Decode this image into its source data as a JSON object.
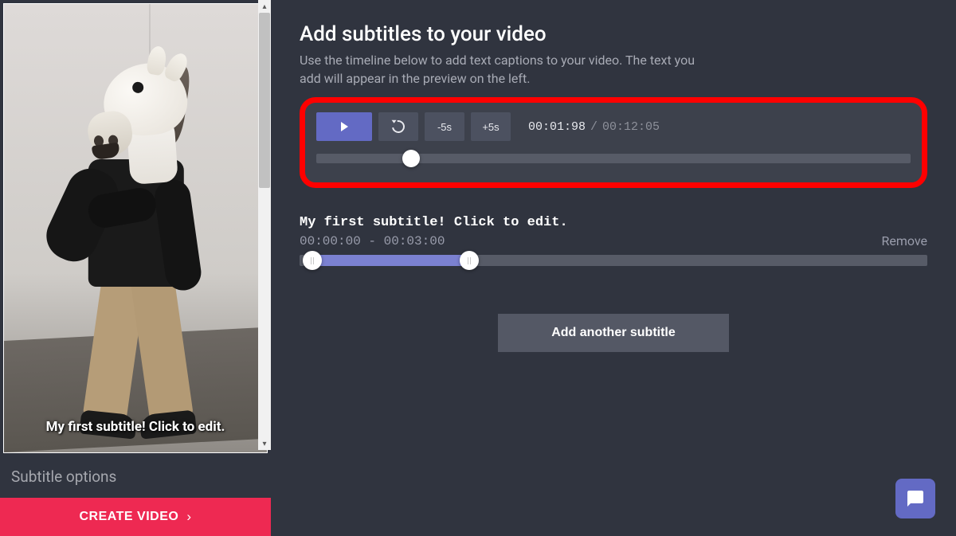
{
  "preview": {
    "subtitle_overlay": "My first subtitle! Click to edit."
  },
  "sidebar": {
    "subtitle_options_header": "Subtitle options",
    "create_button": "CREATE VIDEO"
  },
  "main": {
    "title": "Add subtitles to your video",
    "description": "Use the timeline below to add text captions to your video. The text you add will appear in the preview on the left."
  },
  "controls": {
    "minus5_label": "-5s",
    "plus5_label": "+5s",
    "current_time": "00:01:98",
    "total_time": "00:12:05",
    "progress_percent": 16
  },
  "subtitle": {
    "text": "My first subtitle! Click to edit.",
    "range_text": "00:00:00 - 00:03:00",
    "remove_label": "Remove",
    "start_percent": 2,
    "end_percent": 27
  },
  "actions": {
    "add_subtitle": "Add another subtitle"
  }
}
